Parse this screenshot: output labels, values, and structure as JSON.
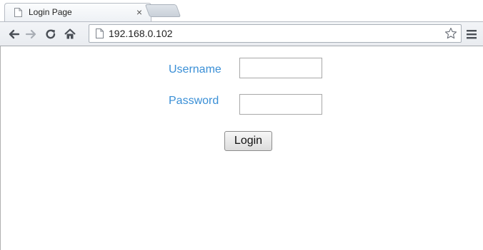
{
  "browser": {
    "tab": {
      "title": "Login Page",
      "close_symbol": "×",
      "favicon": "page-icon"
    },
    "newtab_icon": "new-tab-icon",
    "toolbar": {
      "back_icon": "back-arrow-icon",
      "forward_icon": "forward-arrow-icon",
      "reload_icon": "reload-icon",
      "home_icon": "home-icon",
      "address_url": "192.168.0.102",
      "bookmark_icon": "star-icon",
      "menu_icon": "menu-icon"
    }
  },
  "login_form": {
    "username_label": "Username",
    "username_value": "",
    "password_label": "Password",
    "password_value": "",
    "submit_label": "Login"
  },
  "colors": {
    "label_blue": "#3a8fd6",
    "toolbar_bg": "#eef0f3"
  }
}
